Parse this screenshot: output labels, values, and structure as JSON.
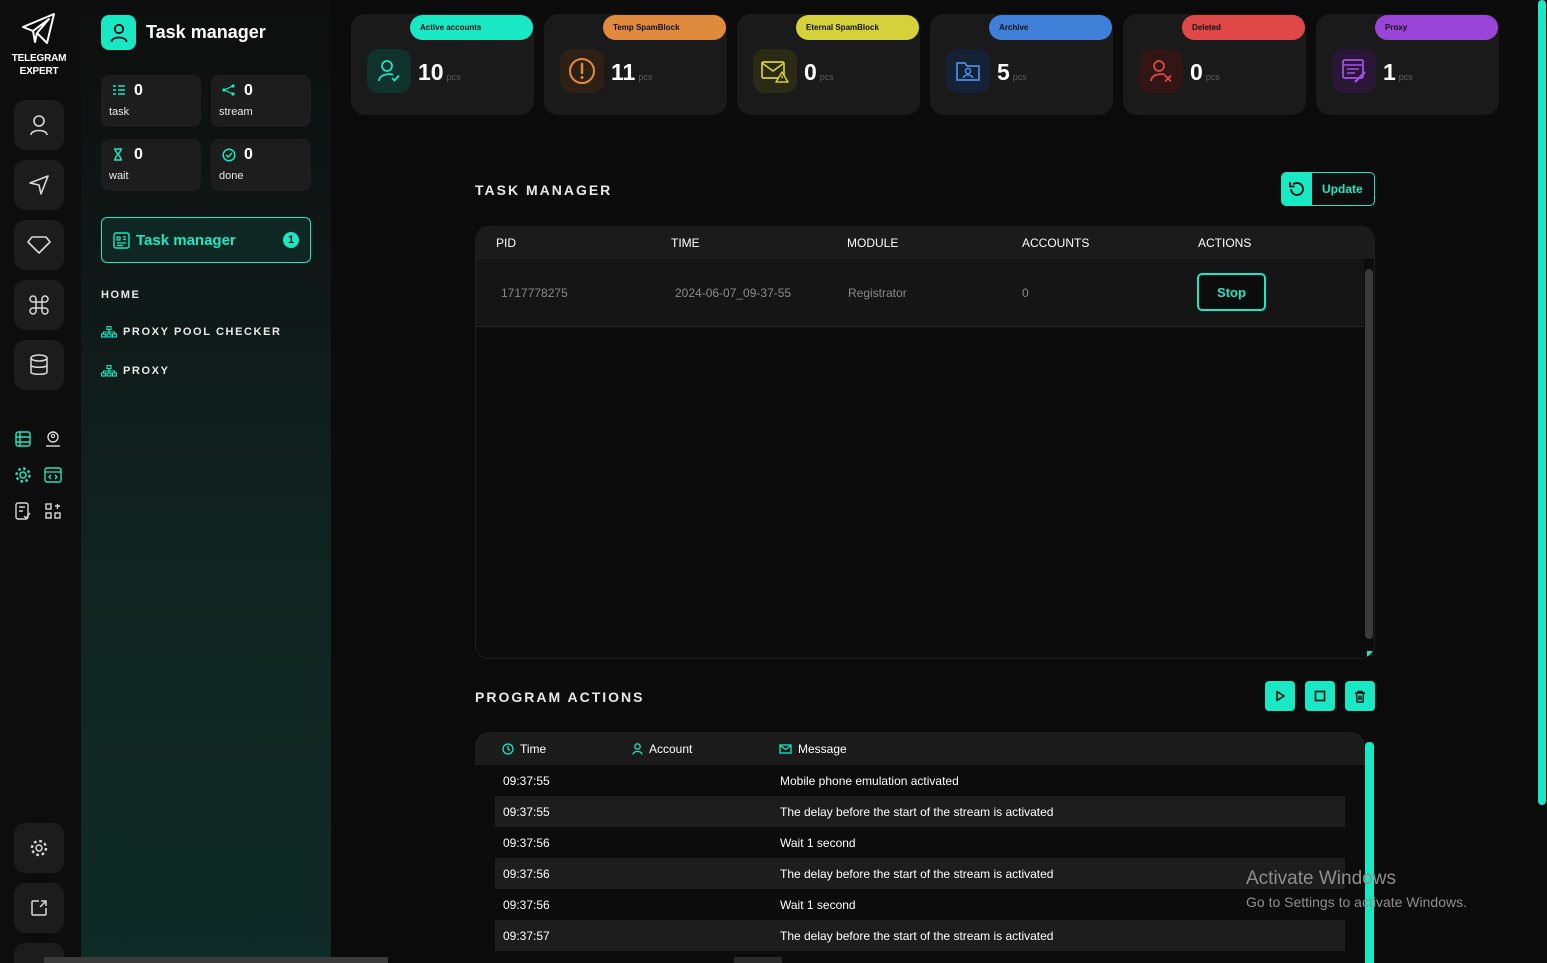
{
  "brand": {
    "line1": "TELEGRAM",
    "line2": "EXPERT"
  },
  "colors": {
    "accent": "#19e8c4",
    "active": "#19e8c4",
    "temp_spamblock": "#e08a3e",
    "eternal_spamblock": "#d5d13b",
    "archive": "#3f7fd8",
    "deleted": "#e04848",
    "proxy": "#9a45d8"
  },
  "panel": {
    "title": "Task manager",
    "stats": {
      "task": {
        "value": "0",
        "label": "task"
      },
      "stream": {
        "value": "0",
        "label": "stream"
      },
      "wait": {
        "value": "0",
        "label": "wait"
      },
      "done": {
        "value": "0",
        "label": "done"
      }
    },
    "task_manager_button": {
      "label": "Task manager",
      "badge": "1"
    },
    "nav": {
      "home": "HOME",
      "proxy_pool_checker": "PROXY POOL CHECKER",
      "proxy": "PROXY"
    }
  },
  "cards": {
    "active": {
      "label": "Active accounts",
      "value": "10",
      "unit": "pcs",
      "icon": "user-check-icon"
    },
    "temp_spamblock": {
      "label": "Temp SpamBlock",
      "value": "11",
      "unit": "pcs",
      "icon": "warning-circle-icon"
    },
    "eternal_spamblock": {
      "label": "Eternal SpamBlock",
      "value": "0",
      "unit": "pcs",
      "icon": "mail-warning-icon"
    },
    "archive": {
      "label": "Archive",
      "value": "5",
      "unit": "pcs",
      "icon": "folder-user-icon"
    },
    "deleted": {
      "label": "Deleted",
      "value": "0",
      "unit": "pcs",
      "icon": "user-x-icon"
    },
    "proxy": {
      "label": "Proxy",
      "value": "1",
      "unit": "pcs",
      "icon": "proxy-icon"
    }
  },
  "task_manager": {
    "title": "TASK MANAGER",
    "update_label": "Update",
    "columns": {
      "pid": "PID",
      "time": "TIME",
      "module": "MODULE",
      "accounts": "ACCOUNTS",
      "actions": "ACTIONS"
    },
    "rows": [
      {
        "pid": "1717778275",
        "time": "2024-06-07_09-37-55",
        "module": "Registrator",
        "accounts": "0",
        "action": "Stop"
      }
    ]
  },
  "program_actions": {
    "title": "PROGRAM ACTIONS",
    "columns": {
      "time": "Time",
      "account": "Account",
      "message": "Message"
    },
    "rows": [
      {
        "time": "09:37:55",
        "account": "",
        "message": "Mobile phone emulation activated"
      },
      {
        "time": "09:37:55",
        "account": "",
        "message": "The delay before the start of the stream is activated"
      },
      {
        "time": "09:37:56",
        "account": "",
        "message": "Wait 1 second"
      },
      {
        "time": "09:37:56",
        "account": "",
        "message": "The delay before the start of the stream is activated"
      },
      {
        "time": "09:37:56",
        "account": "",
        "message": "Wait 1 second"
      },
      {
        "time": "09:37:57",
        "account": "",
        "message": "The delay before the start of the stream is activated"
      }
    ]
  },
  "watermark": {
    "line1": "Activate Windows",
    "line2": "Go to Settings to activate Windows."
  }
}
